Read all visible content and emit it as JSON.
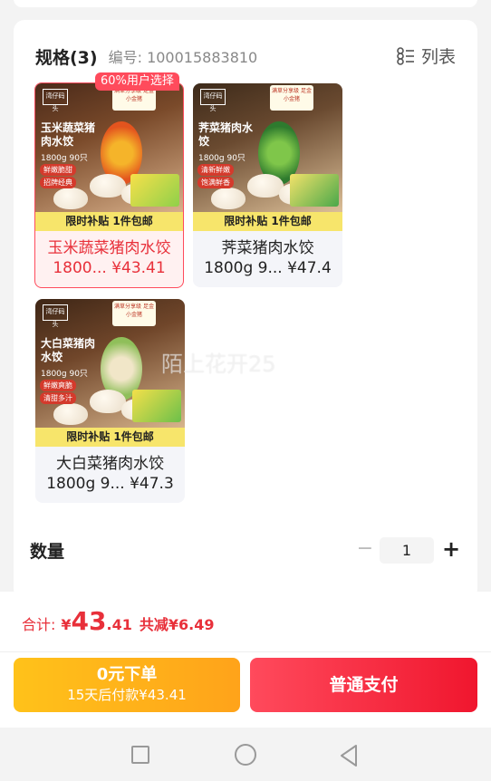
{
  "spec": {
    "title": "规格(3)",
    "code": "编号: 100015883810",
    "list_label": "列表"
  },
  "products": [
    {
      "name": "玉米蔬菜猪肉水饺",
      "meta": "1800... ¥43.41",
      "subsidy": "限时补贴 1件包邮",
      "img_title": "玉米蔬菜猪肉水饺",
      "img_weight": "1800g 90只",
      "tag1": "鲜嫩脆甜",
      "tag2": "招牌经典",
      "badge": "满草分享级 足金小金猪",
      "brand": "湾仔码头",
      "selected": true
    },
    {
      "name": "荠菜猪肉水饺",
      "meta": "1800g 9... ¥47.4",
      "subsidy": "限时补贴 1件包邮",
      "img_title": "荠菜猪肉水饺",
      "img_weight": "1800g 90只",
      "tag1": "清新鲜嫩",
      "tag2": "饱满鲜香",
      "badge": "满草分享级 足金小金猪",
      "brand": "湾仔码头",
      "selected": false
    },
    {
      "name": "大白菜猪肉水饺",
      "meta": "1800g 9... ¥47.3",
      "subsidy": "限时补贴 1件包邮",
      "img_title": "大白菜猪肉水饺",
      "img_weight": "1800g 90只",
      "tag1": "鲜嫩爽脆",
      "tag2": "清甜多汁",
      "badge": "满草分享级 足金小金猪",
      "brand": "湾仔码头",
      "selected": false
    }
  ],
  "popular_badge": "60%用户选择",
  "watermark": "陌上花开25",
  "quantity": {
    "label": "数量",
    "minus": "−",
    "value": "1",
    "plus": "+"
  },
  "total": {
    "label": "合计:",
    "currency": "¥",
    "int": "43",
    "dec": ".41",
    "discount": "共减¥6.49"
  },
  "buttons": {
    "credit_line1": "0元下单",
    "credit_line2": "15天后付款¥43.41",
    "pay": "普通支付"
  },
  "colors": {
    "accent_red": "#e8303a",
    "credit_yellow": "#ffb41a",
    "subsidy_yellow": "#f7e56b"
  }
}
